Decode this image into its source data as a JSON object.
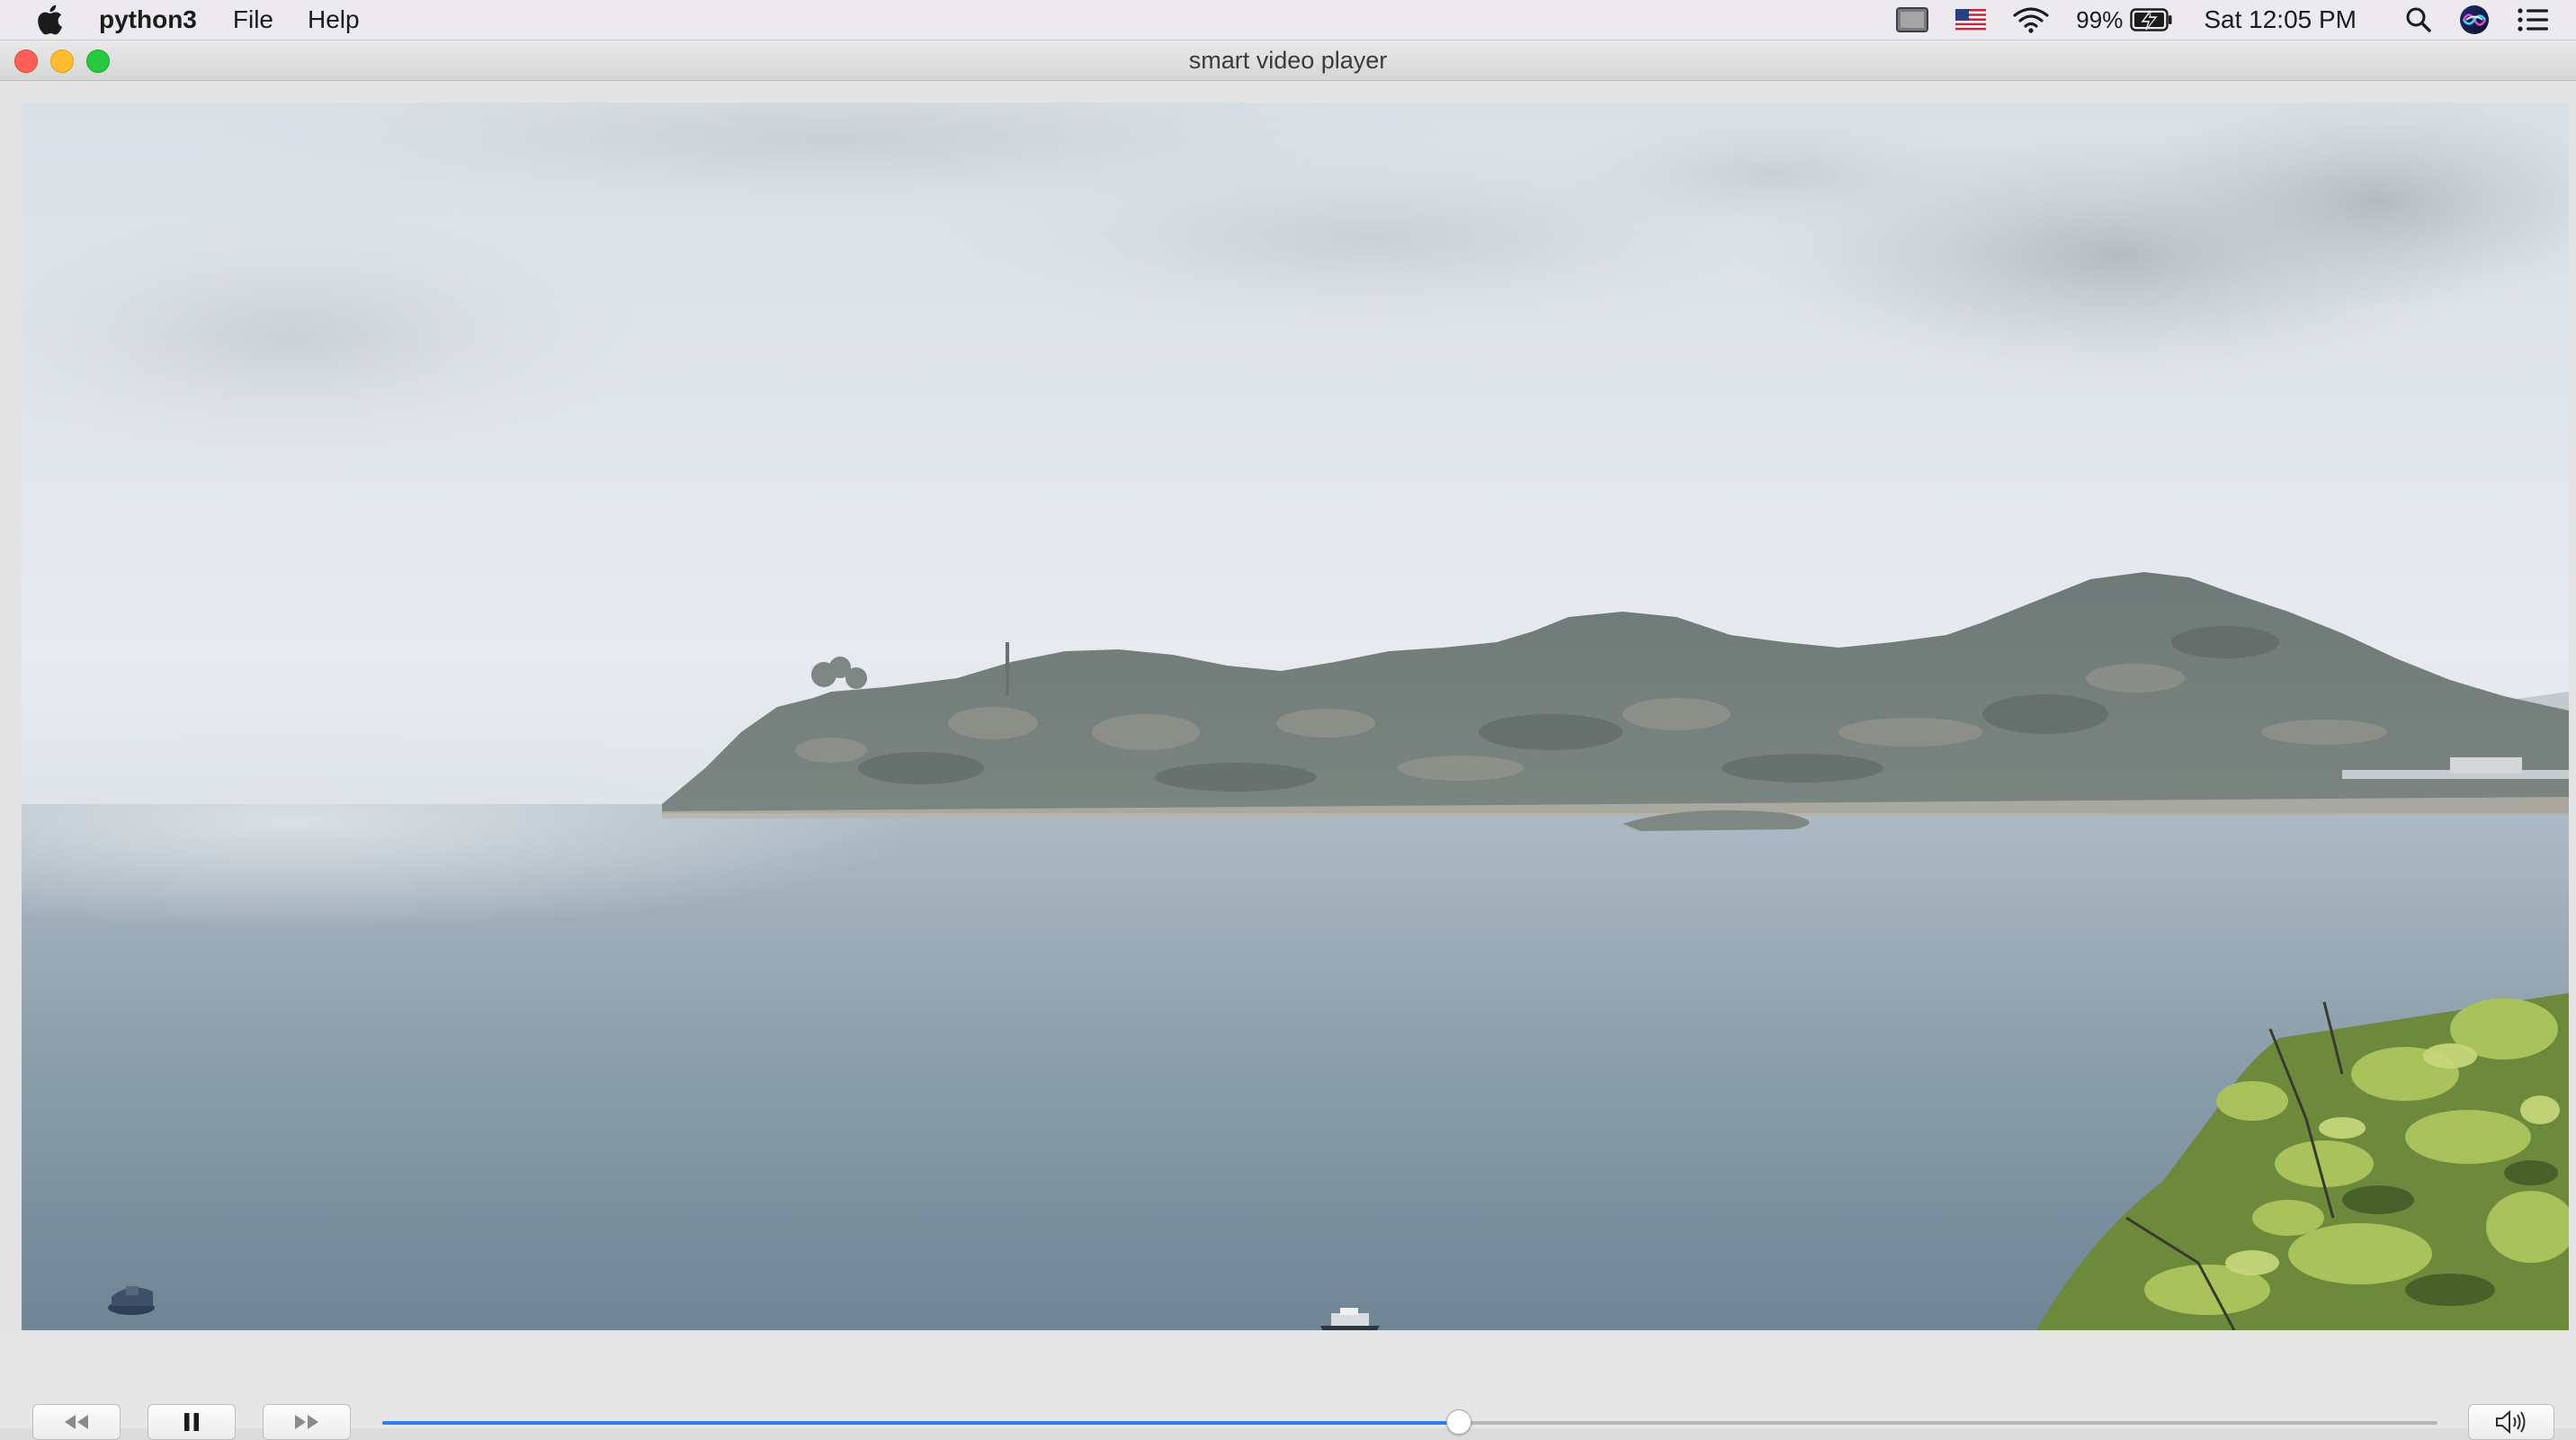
{
  "menubar": {
    "app_name": "python3",
    "menus": [
      "File",
      "Help"
    ],
    "battery_percent": "99%",
    "clock": "Sat 12:05 PM",
    "icons": [
      "apple-icon",
      "display-icon",
      "us-flag-icon",
      "wifi-icon",
      "battery-charging-icon",
      "spotlight-search-icon",
      "siri-icon",
      "notification-center-icon"
    ]
  },
  "window": {
    "title": "smart video player"
  },
  "player": {
    "progress_fraction": 0.524,
    "accent_color": "#2e7cf6",
    "buttons": [
      "rewind-icon",
      "pause-icon",
      "fast-forward-icon",
      "volume-icon"
    ]
  }
}
